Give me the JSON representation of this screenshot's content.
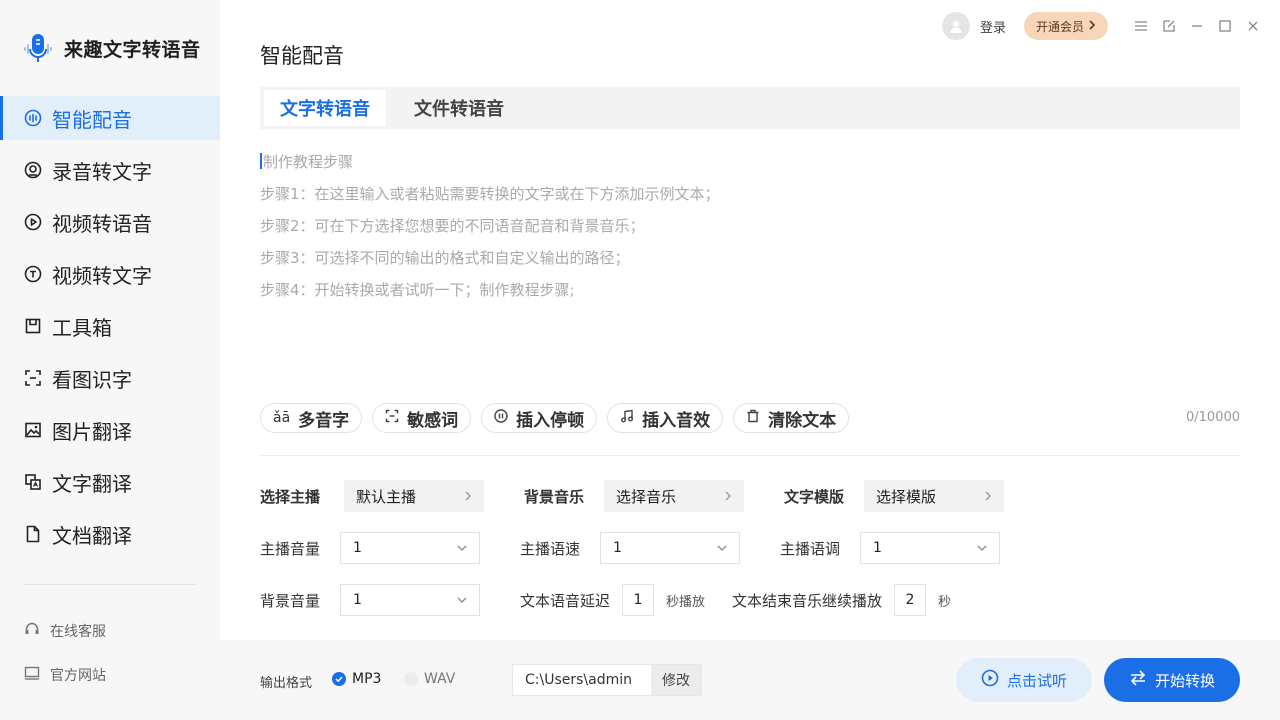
{
  "brand": {
    "name": "来趣文字转语音",
    "logo_icon": "microphone-logo-icon",
    "accent": "#1a6fe6"
  },
  "sidebar": {
    "items": [
      {
        "label": "智能配音",
        "icon": "voice-wave-icon",
        "active": true
      },
      {
        "label": "录音转文字",
        "icon": "record-icon"
      },
      {
        "label": "视频转语音",
        "icon": "play-circle-icon"
      },
      {
        "label": "视频转文字",
        "icon": "text-circle-icon"
      },
      {
        "label": "工具箱",
        "icon": "toolbox-icon"
      },
      {
        "label": "看图识字",
        "icon": "scan-icon"
      },
      {
        "label": "图片翻译",
        "icon": "image-icon"
      },
      {
        "label": "文字翻译",
        "icon": "translate-icon"
      },
      {
        "label": "文档翻译",
        "icon": "document-icon"
      }
    ],
    "footer": [
      {
        "label": "在线客服",
        "icon": "headset-icon"
      },
      {
        "label": "官方网站",
        "icon": "monitor-icon"
      }
    ]
  },
  "header": {
    "login_label": "登录",
    "vip_label": "开通会员"
  },
  "main": {
    "title": "智能配音",
    "tabs": [
      {
        "label": "文字转语音",
        "active": true
      },
      {
        "label": "文件转语音"
      }
    ],
    "editor_placeholder": [
      "制作教程步骤",
      "步骤1：在这里输入或者粘贴需要转换的文字或在下方添加示例文本；",
      "步骤2：可在下方选择您想要的不同语音配音和背景音乐；",
      "步骤3：可选择不同的输出的格式和自定义输出的路径；",
      "步骤4：开始转换或者试听一下；制作教程步骤;"
    ],
    "tools": [
      {
        "label": "多音字",
        "icon": "pinyin-icon"
      },
      {
        "label": "敏感词",
        "icon": "scan-icon"
      },
      {
        "label": "插入停顿",
        "icon": "pause-icon"
      },
      {
        "label": "插入音效",
        "icon": "music-note-icon"
      },
      {
        "label": "清除文本",
        "icon": "trash-icon"
      }
    ],
    "counter": "0/10000",
    "settings": {
      "anchor": {
        "label": "选择主播",
        "value": "默认主播"
      },
      "bgm": {
        "label": "背景音乐",
        "value": "选择音乐"
      },
      "template": {
        "label": "文字模版",
        "value": "选择模版"
      },
      "anchor_volume": {
        "label": "主播音量",
        "value": "1"
      },
      "anchor_speed": {
        "label": "主播语速",
        "value": "1"
      },
      "anchor_pitch": {
        "label": "主播语调",
        "value": "1"
      },
      "bg_volume": {
        "label": "背景音量",
        "value": "1"
      },
      "delay": {
        "label": "文本语音延迟",
        "value": "1",
        "unit": "秒播放"
      },
      "bgm_after": {
        "label": "文本结束音乐继续播放",
        "value": "2",
        "unit": "秒"
      }
    }
  },
  "bottom": {
    "format_label": "输出格式",
    "formats": [
      {
        "label": "MP3",
        "selected": true
      },
      {
        "label": "WAV",
        "selected": false
      }
    ],
    "path_value": "C:\\Users\\admin",
    "path_button": "修改",
    "preview_label": "点击试听",
    "start_label": "开始转换"
  }
}
